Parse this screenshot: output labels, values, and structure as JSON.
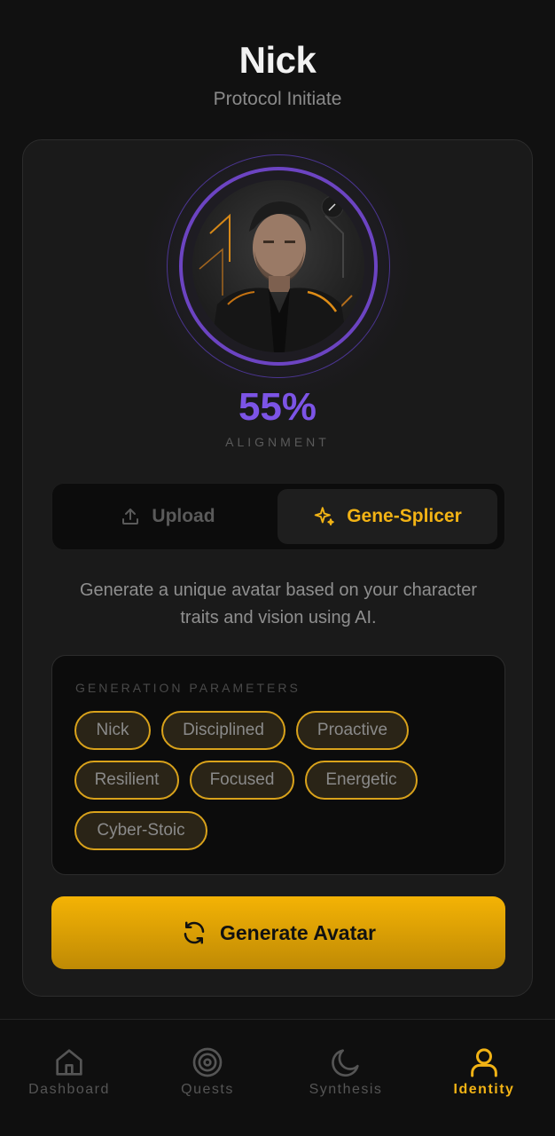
{
  "profile": {
    "name": "Nick",
    "rank": "Protocol Initiate"
  },
  "alignment": {
    "value": "55%",
    "label": "ALIGNMENT",
    "fraction": 0.55
  },
  "mode_toggle": {
    "tabs": [
      {
        "label": "Upload",
        "icon": "upload-icon",
        "active": false
      },
      {
        "label": "Gene-Splicer",
        "icon": "sparkle-icon",
        "active": true
      }
    ]
  },
  "description": "Generate a unique avatar based on your character traits and vision using AI.",
  "parameters": {
    "label": "GENERATION PARAMETERS",
    "traits": [
      "Nick",
      "Disciplined",
      "Proactive",
      "Resilient",
      "Focused",
      "Energetic",
      "Cyber-Stoic"
    ]
  },
  "generate_button": {
    "label": "Generate Avatar",
    "icon": "refresh-icon"
  },
  "bottom_nav": {
    "items": [
      {
        "label": "Dashboard",
        "icon": "home-icon",
        "active": false
      },
      {
        "label": "Quests",
        "icon": "target-icon",
        "active": false
      },
      {
        "label": "Synthesis",
        "icon": "moon-icon",
        "active": false
      },
      {
        "label": "Identity",
        "icon": "user-icon",
        "active": true
      }
    ]
  },
  "colors": {
    "accent": "#f2b315",
    "alignment_purple": "#7c54e6",
    "ring_purple": "#6c44c2",
    "background": "#111111",
    "card": "#1a1a1a"
  }
}
